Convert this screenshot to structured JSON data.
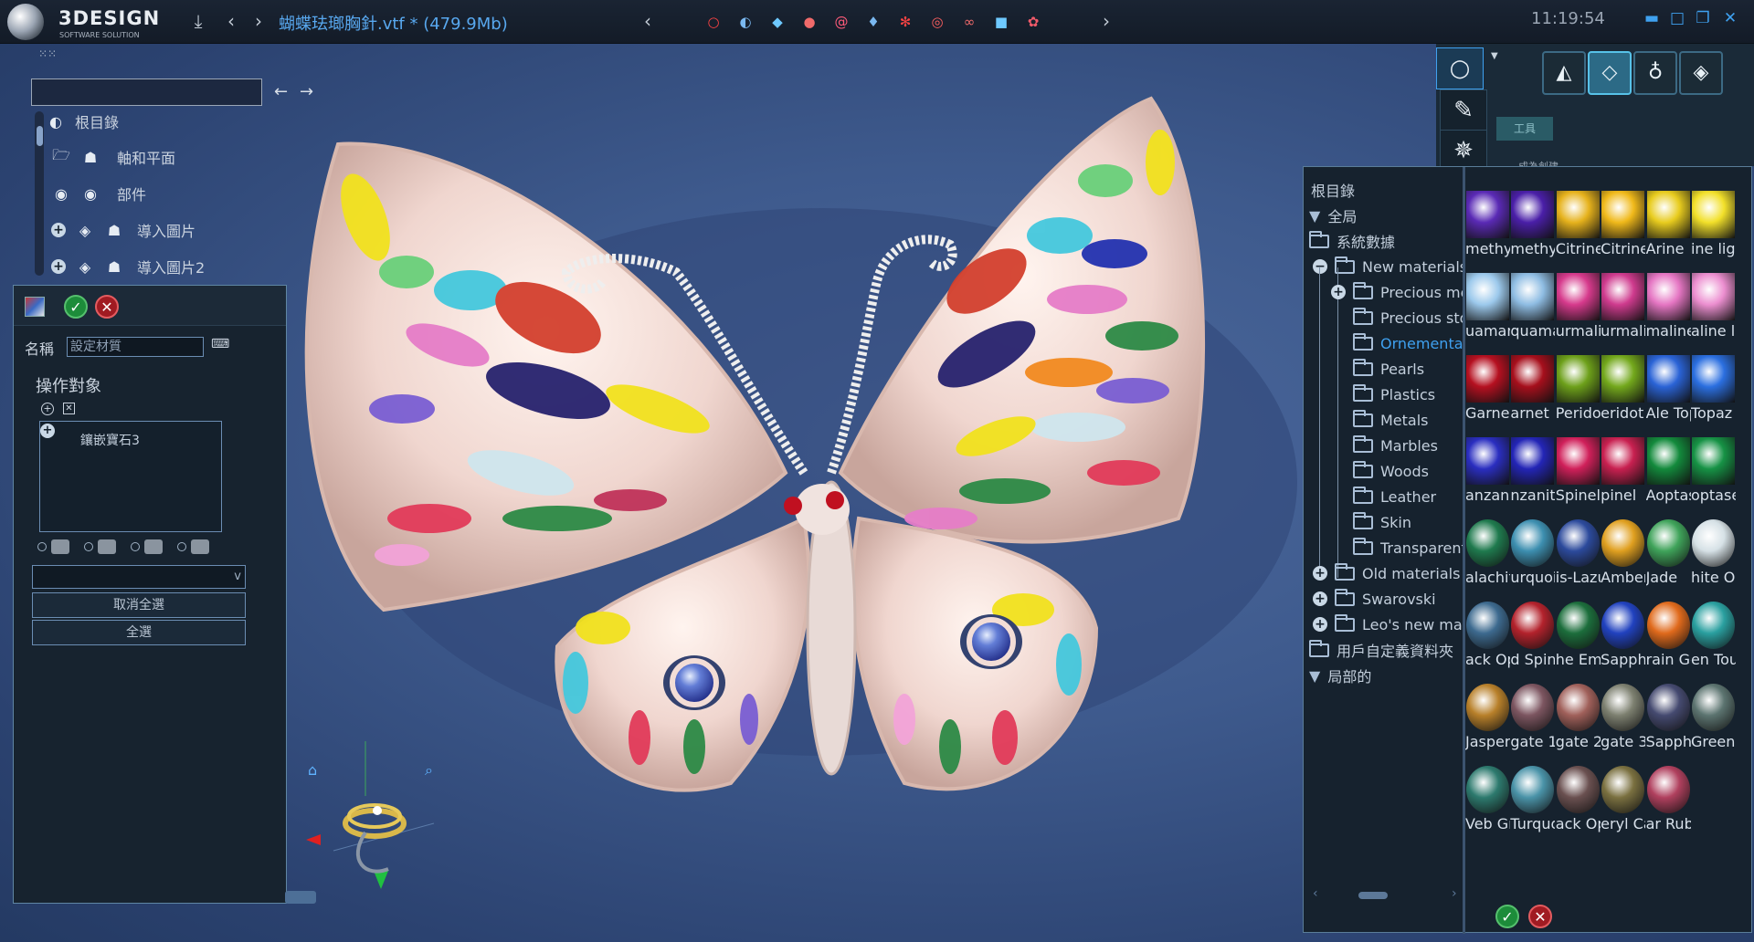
{
  "app": {
    "logo_name": "3DESIGN",
    "logo_sub": "SOFTWARE SOLUTION",
    "title": "蝴蝶珐瑯胸針.vtf *  (479.9Mb)",
    "clock": "11:19:54"
  },
  "colors": {
    "accent": "#3fa1f0",
    "ok": "#1d8c3a",
    "cancel": "#a01b22"
  },
  "jewelry_icons": [
    "ring-icon",
    "shell-icon",
    "gem-icon",
    "multi-gem-icon",
    "spiral-icon",
    "drop-icon",
    "cluster-icon",
    "bangle-icon",
    "chain-icon",
    "cube-icon",
    "molecule-icon"
  ],
  "scene_tree": {
    "root": "根目錄",
    "items": [
      {
        "label": "軸和平面"
      },
      {
        "label": "部件"
      },
      {
        "label": "導入圖片"
      },
      {
        "label": "導入圖片2"
      }
    ]
  },
  "material_dialog": {
    "name_label": "名稱",
    "name_value": "設定材質",
    "targets_label": "操作對象",
    "list_item": "鑲嵌寶石3",
    "deselect_all": "取消全選",
    "select_all": "全選",
    "combo_arrow": "v"
  },
  "tools_tab": "工具",
  "tools_subtext": "成為創建",
  "library": {
    "root": "根目錄",
    "nodes": [
      {
        "label": "全局"
      },
      {
        "label": "系統數據"
      },
      {
        "label": "New materials"
      },
      {
        "label": "Precious metals"
      },
      {
        "label": "Precious stones"
      },
      {
        "label": "Ornementals"
      },
      {
        "label": "Pearls"
      },
      {
        "label": "Plastics"
      },
      {
        "label": "Metals"
      },
      {
        "label": "Marbles"
      },
      {
        "label": "Woods"
      },
      {
        "label": "Leather"
      },
      {
        "label": "Skin"
      },
      {
        "label": "Transparent"
      },
      {
        "label": "Old materials"
      },
      {
        "label": "Swarovski"
      },
      {
        "label": "Leo's new materials"
      },
      {
        "label": "用戶自定義資料夾"
      },
      {
        "label": "局部的"
      }
    ],
    "materials": [
      {
        "name": "methyst",
        "color": "#5a2ab5"
      },
      {
        "name": "methyst",
        "color": "#4a1fa8"
      },
      {
        "name": "Citrine",
        "color": "#e6b21c"
      },
      {
        "name": "Citrine",
        "color": "#f0b91a"
      },
      {
        "name": "Arine",
        "color": "#e8cc1e"
      },
      {
        "name": "ine light",
        "color": "#f2e02a"
      },
      {
        "name": "uamarine",
        "color": "#9cc9ec"
      },
      {
        "name": "quamarine",
        "color": "#8fbde3"
      },
      {
        "name": "urmaline",
        "color": "#d63a8c"
      },
      {
        "name": "urmaline",
        "color": "#cf3b8e"
      },
      {
        "name": "maline",
        "color": "#e576c3"
      },
      {
        "name": "aline li",
        "color": "#ec8fd0"
      },
      {
        "name": "Garnet",
        "color": "#b51020"
      },
      {
        "name": "arnet",
        "color": "#a60f1c"
      },
      {
        "name": "Peridot",
        "color": "#6da01a"
      },
      {
        "name": "eridot",
        "color": "#73a81c"
      },
      {
        "name": "Ale Topaz",
        "color": "#2a63d6"
      },
      {
        "name": "Topaz",
        "color": "#2b6fe0"
      },
      {
        "name": "anzanite",
        "color": "#2a2ec0"
      },
      {
        "name": "nzanite",
        "color": "#2325b6"
      },
      {
        "name": "Spinel",
        "color": "#d0205a"
      },
      {
        "name": "pinel",
        "color": "#c82050"
      },
      {
        "name": "Aoptase",
        "color": "#138a3c"
      },
      {
        "name": "optase",
        "color": "#169245"
      },
      {
        "name": "alachite",
        "color": "#1f7a4e"
      },
      {
        "name": "urquoise",
        "color": "#3d8fb0"
      },
      {
        "name": "is-Lazuli",
        "color": "#2c4a9c"
      },
      {
        "name": "Amber",
        "color": "#e0a020"
      },
      {
        "name": "Jade",
        "color": "#3fa35a"
      },
      {
        "name": "hite Opal",
        "color": "#d6e1e6"
      },
      {
        "name": "ack Opal",
        "color": "#3d6a8f"
      },
      {
        "name": "d Spinel",
        "color": "#b3222c"
      },
      {
        "name": "he Emald",
        "color": "#1c6e3c"
      },
      {
        "name": "Sapphire",
        "color": "#2142bf"
      },
      {
        "name": "rain Gem",
        "color": "#e06a1c"
      },
      {
        "name": "en Tour",
        "color": "#2aa0a0"
      },
      {
        "name": "Jasper",
        "color": "#b8802a"
      },
      {
        "name": "gate 1",
        "color": "#7c5560"
      },
      {
        "name": "gate 2",
        "color": "#a0605a"
      },
      {
        "name": "gate 3",
        "color": "#7d8070"
      },
      {
        "name": "Sapphire",
        "color": "#454a70"
      },
      {
        "name": "Green",
        "color": "#5c7470"
      },
      {
        "name": "Veb Green",
        "color": "#2d7a6e"
      },
      {
        "name": "Turquoise",
        "color": "#4a93a8"
      },
      {
        "name": "ack Opal",
        "color": "#6a5050"
      },
      {
        "name": "eryl Cat",
        "color": "#7a7040"
      },
      {
        "name": "ar Rub",
        "color": "#b0405e"
      }
    ]
  }
}
